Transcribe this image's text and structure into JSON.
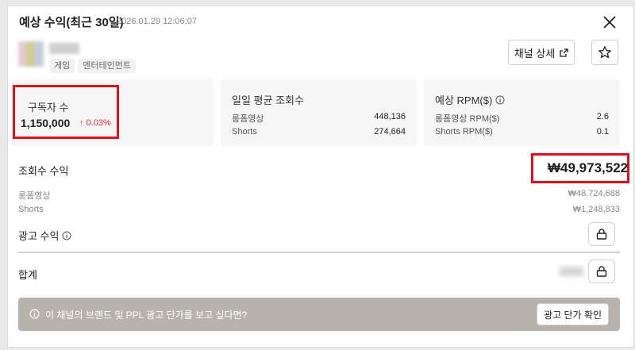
{
  "header": {
    "title": "예상 수익(최근 30일)",
    "timestamp": "2026.01.29 12:06:07"
  },
  "channel": {
    "tags": [
      "게임",
      "엔터테인먼트"
    ],
    "detail_button": "채널 상세"
  },
  "cards": {
    "subscribers": {
      "title": "구독자 수",
      "value": "1,150,000",
      "change": "↑ 0.03%"
    },
    "daily_views": {
      "title": "일일 평균 조회수",
      "rows": [
        {
          "label": "롱폼영상",
          "value": "448,136"
        },
        {
          "label": "Shorts",
          "value": "274,664"
        }
      ]
    },
    "rpm": {
      "title": "예상 RPM($)",
      "rows": [
        {
          "label": "롱폼영상 RPM($)",
          "value": "2.6"
        },
        {
          "label": "Shorts RPM($)",
          "value": "0.1"
        }
      ]
    }
  },
  "revenue": {
    "label": "조회수 수익",
    "total": "₩49,973,522",
    "rows": [
      {
        "label": "롱폼영상",
        "value": "₩48,724,688"
      },
      {
        "label": "Shorts",
        "value": "₩1,248,833"
      }
    ]
  },
  "ad_revenue": {
    "label": "광고 수익"
  },
  "sum": {
    "label": "합계"
  },
  "banner": {
    "text": "이 채널의 브랜드 및 PPL 광고 단가를 보고 싶다면?",
    "button": "광고 단가 확인"
  },
  "colors": {
    "highlight": "#e0101a",
    "increase": "#e0303c",
    "banner_bg": "#b8b2ad"
  },
  "icons": [
    "close-icon",
    "external-link-icon",
    "star-icon",
    "info-icon",
    "lock-icon"
  ]
}
